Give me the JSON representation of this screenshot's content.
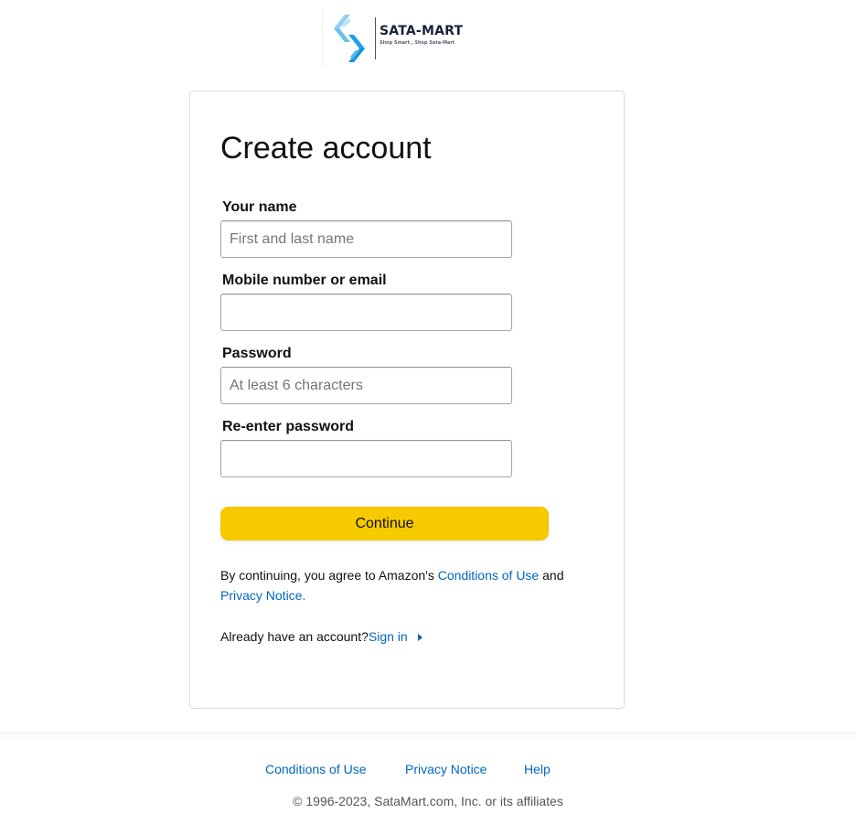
{
  "brand": {
    "name": "SATA-MART",
    "tagline": "Shop Smart , Shop Sata-Mart"
  },
  "form": {
    "title": "Create account",
    "fields": [
      {
        "label": "Your name",
        "placeholder": "First and last name",
        "value": ""
      },
      {
        "label": "Mobile number or email",
        "placeholder": "",
        "value": ""
      },
      {
        "label": "Password",
        "placeholder": "At least 6 characters",
        "value": ""
      },
      {
        "label": "Re-enter password",
        "placeholder": "",
        "value": ""
      }
    ],
    "continue_label": "Continue",
    "legal": {
      "prefix": "By continuing, you agree to Amazon's ",
      "conditions_link": "Conditions of Use",
      "middle": " and",
      "privacy_link": "Privacy Notice."
    },
    "signin": {
      "prompt": "Already have an account?",
      "link": "Sign in"
    }
  },
  "footer": {
    "links": [
      "Conditions of Use",
      "Privacy Notice",
      "Help"
    ],
    "copyright": "© 1996-2023, SataMart.com, Inc. or its affiliates"
  },
  "colors": {
    "accent_button": "#f7ca00",
    "link": "#0066c0",
    "logo_blue": "#1aa3e8",
    "logo_light_blue": "#8fd0f3"
  },
  "icons": {
    "logo": "sata-mart-logo-icon",
    "signin_caret": "caret-right-icon"
  }
}
